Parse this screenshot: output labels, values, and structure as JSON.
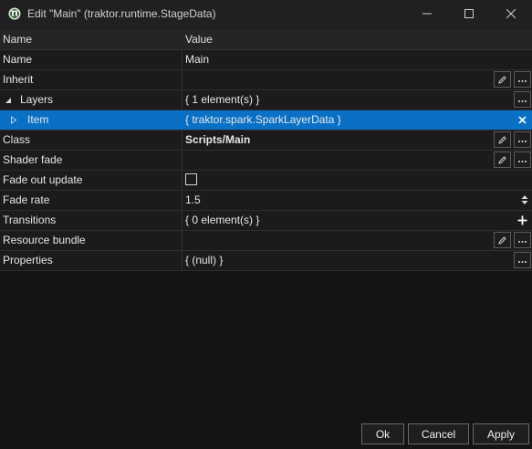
{
  "window": {
    "title": "Edit \"Main\" (traktor.runtime.StageData)",
    "app_icon": "traktor-logo-icon"
  },
  "grid": {
    "columns": {
      "name": "Name",
      "value": "Value"
    },
    "rows": [
      {
        "name": "Name",
        "value": "Main"
      },
      {
        "name": "Inherit",
        "value": ""
      },
      {
        "name": "Layers",
        "value": "{ 1 element(s) }",
        "expanded": true
      },
      {
        "name": "Item",
        "value": "{ traktor.spark.SparkLayerData }",
        "selected": true
      },
      {
        "name": "Class",
        "value": "Scripts/Main"
      },
      {
        "name": "Shader fade",
        "value": ""
      },
      {
        "name": "Fade out update",
        "value": "",
        "checked": false
      },
      {
        "name": "Fade rate",
        "value": "1.5"
      },
      {
        "name": "Transitions",
        "value": "{ 0 element(s) }"
      },
      {
        "name": "Resource bundle",
        "value": ""
      },
      {
        "name": "Properties",
        "value": "{ (null) }"
      }
    ],
    "button_labels": {
      "more": "..."
    }
  },
  "buttons": {
    "ok": "Ok",
    "cancel": "Cancel",
    "apply": "Apply"
  },
  "colors": {
    "selection": "#0a70c6",
    "background": "#141414",
    "row": "#1b1b1b"
  }
}
